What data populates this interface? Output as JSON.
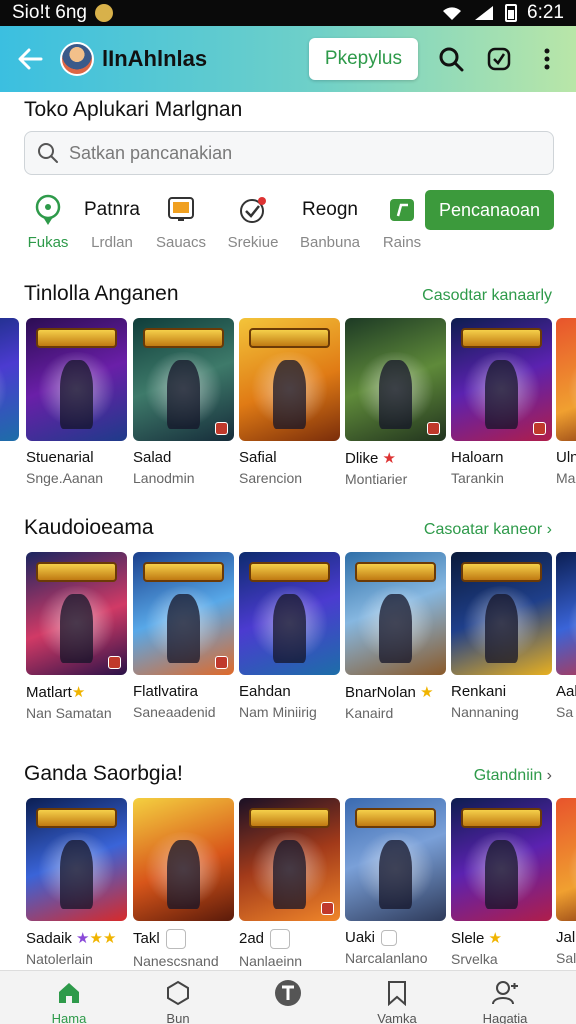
{
  "status_bar": {
    "carrier": "Sio!t 6ng",
    "time": "6:21"
  },
  "app_bar": {
    "title": "lInAhlnlas",
    "action_pill": "Pkepylus"
  },
  "store_title": "Toko Aplukari Marlgnan",
  "search": {
    "placeholder": "Satkan pancanakian"
  },
  "categories": [
    {
      "label": "Fukas",
      "icon": "search-pin-icon",
      "active": true
    },
    {
      "label": "Lrdlan",
      "big_text": "Patnra"
    },
    {
      "label": "Sauacs",
      "icon": "tablet-icon"
    },
    {
      "label": "Srekiue",
      "icon": "check-badge-icon"
    },
    {
      "label": "Banbuna",
      "big_text": "Reogn"
    },
    {
      "label": "Rains",
      "icon": "green-card-icon"
    }
  ],
  "category_cta": "Pencanaoan",
  "sections": [
    {
      "title": "Tinlolla Anganen",
      "link": "Casodtar kanaarly",
      "items": [
        {
          "name": "Stuenarial",
          "sub": "Snge.Aanan"
        },
        {
          "name": "Salad",
          "sub": "Lanodmin"
        },
        {
          "name": "Safial",
          "sub": "Sarencion"
        },
        {
          "name": "Dlike",
          "sub": "Montiarier"
        },
        {
          "name": "Haloarn",
          "sub": "Tarankin"
        },
        {
          "name": "Uln",
          "sub": "Ma"
        }
      ]
    },
    {
      "title": "Kaudoioeama",
      "link": "Casoatar kaneor",
      "items": [
        {
          "name": "Matlart",
          "sub": "Nan Samatan"
        },
        {
          "name": "Flatlvatira",
          "sub": "Saneaadenid"
        },
        {
          "name": "Eahdan",
          "sub": "Nam Miniirig"
        },
        {
          "name": "BnarNolan",
          "sub": "Kanaird"
        },
        {
          "name": "Renkani",
          "sub": "Nannaning"
        },
        {
          "name": "Aal",
          "sub": "Sa"
        }
      ]
    },
    {
      "title": "Ganda Saorbgia!",
      "link": "Gtandniin",
      "items": [
        {
          "name": "Sadaik",
          "sub": "Natolerlain"
        },
        {
          "name": "Takl",
          "sub": "Nanescsnand"
        },
        {
          "name": "2ad",
          "sub": "Nanlaeinn"
        },
        {
          "name": "Uaki",
          "sub": "Narcalanlano"
        },
        {
          "name": "Slele",
          "sub": "Srvelka"
        },
        {
          "name": "Jal",
          "sub": "Sal"
        }
      ]
    }
  ],
  "bottom_nav": [
    {
      "label": "Hama",
      "icon": "home-icon",
      "active": true
    },
    {
      "label": "Bun",
      "icon": "hexagon-icon"
    },
    {
      "label": "",
      "icon": "t-circle-icon"
    },
    {
      "label": "Vamka",
      "icon": "bookmark-icon"
    },
    {
      "label": "Hagatia",
      "icon": "profile-icon"
    }
  ],
  "colors": {
    "accent": "#2e9a4a",
    "cta": "#3c9a3c",
    "appbar_start": "#3bbfe0",
    "appbar_end": "#b9e6a8"
  }
}
